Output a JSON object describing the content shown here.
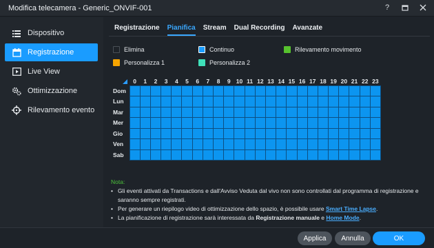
{
  "window": {
    "title": "Modifica telecamera - Generic_ONVIF-001",
    "help": "?"
  },
  "sidebar": {
    "items": [
      {
        "label": "Dispositivo"
      },
      {
        "label": "Registrazione",
        "active": true
      },
      {
        "label": "Live View"
      },
      {
        "label": "Ottimizzazione"
      },
      {
        "label": "Rilevamento evento"
      }
    ]
  },
  "tabs": [
    "Registrazione",
    "Pianifica",
    "Stream",
    "Dual Recording",
    "Avanzate"
  ],
  "active_tab": "Pianifica",
  "legend": {
    "elimina": {
      "label": "Elimina",
      "color": "#1e2329"
    },
    "continuo": {
      "label": "Continuo",
      "color": "#1a9cff"
    },
    "rilevamento": {
      "label": "Rilevamento movimento",
      "color": "#57c22e"
    },
    "pers1": {
      "label": "Personalizza 1",
      "color": "#f6a400"
    },
    "pers2": {
      "label": "Personalizza 2",
      "color": "#3fe0b9"
    }
  },
  "schedule": {
    "hours": [
      "0",
      "1",
      "2",
      "3",
      "4",
      "5",
      "6",
      "7",
      "8",
      "9",
      "10",
      "11",
      "12",
      "13",
      "14",
      "15",
      "16",
      "17",
      "18",
      "19",
      "20",
      "21",
      "22",
      "23"
    ],
    "days": [
      "Dom",
      "Lun",
      "Mar",
      "Mer",
      "Gio",
      "Ven",
      "Sab"
    ]
  },
  "notes": {
    "title": "Nota:",
    "n1": "Gli eventi attivati da Transactions e dall'Avviso Veduta dal vivo non sono controllati dal programma di registrazione e saranno sempre registrati.",
    "n2_prefix": "Per generare un riepilogo video di ottimizzazione dello spazio, è possibile usare ",
    "n2_link": "Smart Time Lapse",
    "n2_suffix": ".",
    "n3_prefix": "La pianificazione di registrazione sarà interessata da ",
    "n3_strong": "Registrazione manuale",
    "n3_mid": " e ",
    "n3_link": "Home Mode",
    "n3_suffix": "."
  },
  "buttons": {
    "apply": "Applica",
    "cancel": "Annulla",
    "ok": "OK"
  }
}
